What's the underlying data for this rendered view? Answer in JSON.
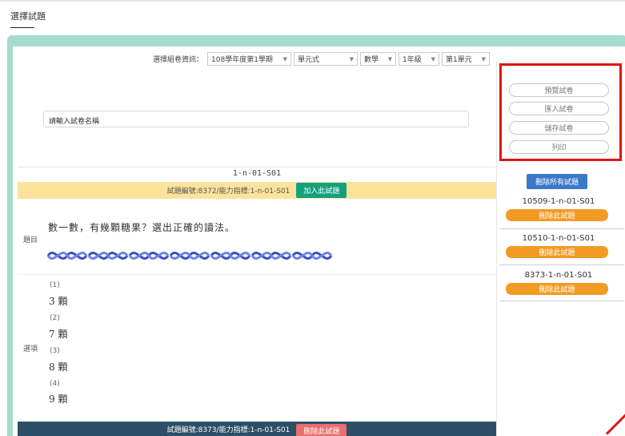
{
  "page": {
    "title": "選擇試題"
  },
  "filter": {
    "label": "選擇組卷資訊：",
    "selects": [
      {
        "value": "108學年度第1學期"
      },
      {
        "value": "單元式"
      },
      {
        "value": "數學"
      },
      {
        "value": "1年級"
      },
      {
        "value": "第1單元"
      }
    ]
  },
  "exam_name": {
    "value": "請輸入試卷名稱"
  },
  "question": {
    "code": "1-n-01-S01",
    "info": "試題編號:8372/能力指標:1-n-01-S01",
    "add_button": "加入此試題",
    "stem_label": "題目",
    "stem_text": "數一數，有幾顆糖果？選出正確的讀法。",
    "options_label": "選項",
    "options": [
      {
        "num": "(1)",
        "text": "3 顆"
      },
      {
        "num": "(2)",
        "text": "7 顆"
      },
      {
        "num": "(3)",
        "text": "8 顆"
      },
      {
        "num": "(4)",
        "text": "9 顆"
      }
    ]
  },
  "next_question": {
    "info": "試題編號:8373/能力指標:1-n-01-S01",
    "remove_button": "刪除此試題"
  },
  "actions": {
    "buttons": [
      "預覽試卷",
      "匯入試卷",
      "儲存試卷",
      "列印"
    ]
  },
  "selected": {
    "clear_all": "刪除所有試題",
    "items": [
      {
        "code": "10509-1-n-01-S01",
        "remove": "刪除此試題"
      },
      {
        "code": "10510-1-n-01-S01",
        "remove": "刪除此試題"
      },
      {
        "code": "8373-1-n-01-S01",
        "remove": "刪除此試題"
      }
    ]
  },
  "colors": {
    "frame": "#a6dccd",
    "info_bar": "#fce29b",
    "add_button": "#13a17c",
    "dark_bar": "#2d4e66",
    "remove_red": "#e8706e",
    "clear_blue": "#3b78c9",
    "remove_orange": "#f29b23",
    "highlight": "#e01414"
  }
}
